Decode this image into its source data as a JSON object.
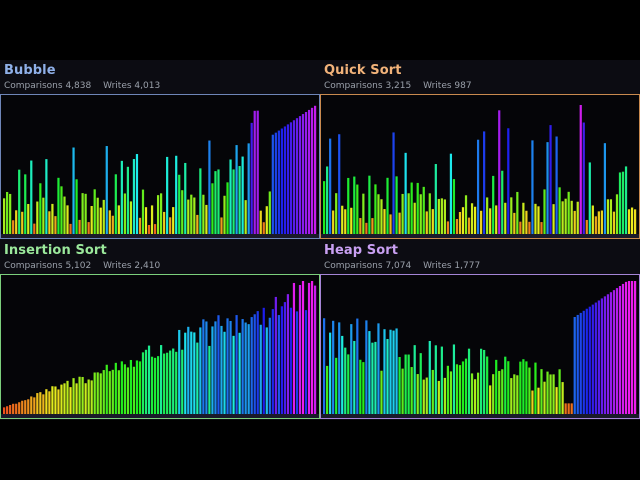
{
  "panels": [
    {
      "id": "bubble",
      "title": "Bubble",
      "comparisons_label": "Comparisons",
      "comparisons": "4,838",
      "writes_label": "Writes",
      "writes": "4,013",
      "accent": "#8fb0e8",
      "border": "#6f86b8",
      "bar_count": 104,
      "profile": "bubble"
    },
    {
      "id": "quick",
      "title": "Quick Sort",
      "comparisons_label": "Comparisons",
      "comparisons": "3,215",
      "writes_label": "Writes",
      "writes": "987",
      "accent": "#f2b37a",
      "border": "#c98a4f",
      "bar_count": 104,
      "profile": "quick"
    },
    {
      "id": "insertion",
      "title": "Insertion Sort",
      "comparisons_label": "Comparisons",
      "comparisons": "5,102",
      "writes_label": "Writes",
      "writes": "2,410",
      "accent": "#9be89b",
      "border": "#7ccf7c",
      "bar_count": 104,
      "profile": "insertion"
    },
    {
      "id": "heap",
      "title": "Heap Sort",
      "comparisons_label": "Comparisons",
      "comparisons": "7,074",
      "writes_label": "Writes",
      "writes": "1,777",
      "accent": "#c9a0f2",
      "border": "#a585d6",
      "bar_count": 104,
      "profile": "heap"
    }
  ]
}
